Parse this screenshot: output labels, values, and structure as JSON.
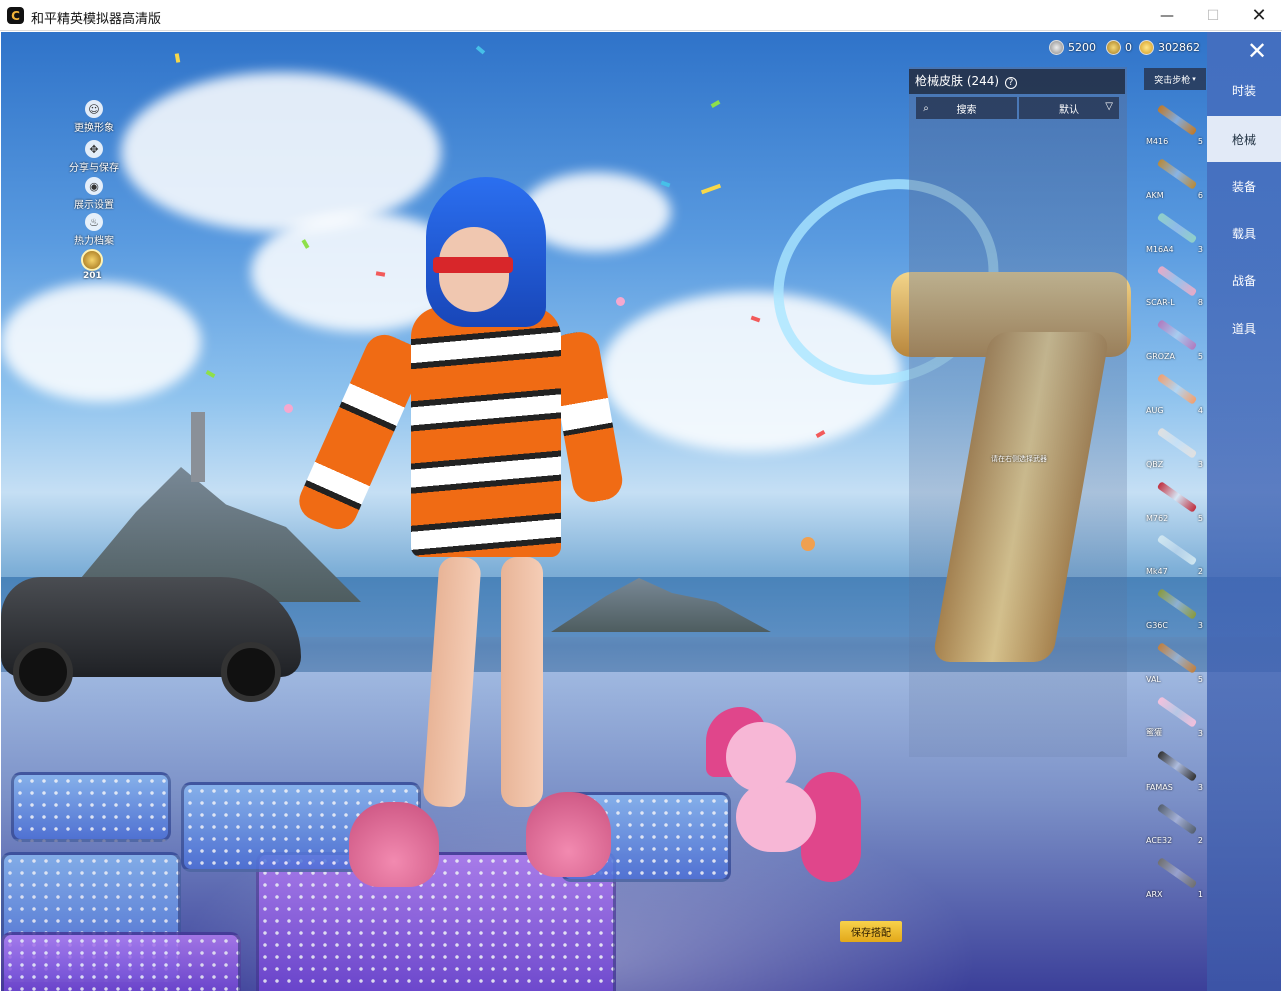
{
  "window": {
    "title": "和平精英模拟器高清版",
    "icon_label": "C",
    "controls": {
      "minimize": "—",
      "maximize": "☐",
      "close": "✕"
    }
  },
  "left_menu": {
    "items": [
      {
        "label": "更换形象",
        "icon": "person-icon"
      },
      {
        "label": "分享与保存",
        "icon": "share-icon"
      },
      {
        "label": "展示设置",
        "icon": "eye-icon"
      },
      {
        "label": "热力档案",
        "icon": "flame-icon"
      }
    ],
    "level_badge": "201"
  },
  "currency": {
    "silver": "5200",
    "tokens": "0",
    "gold": "302862"
  },
  "right_tabs": {
    "close": "✕",
    "items": [
      {
        "label": "时装",
        "active": false
      },
      {
        "label": "枪械",
        "active": true
      },
      {
        "label": "装备",
        "active": false
      },
      {
        "label": "载具",
        "active": false
      },
      {
        "label": "战备",
        "active": false
      },
      {
        "label": "道具",
        "active": false
      }
    ]
  },
  "skin_panel": {
    "title": "枪械皮肤 (244)",
    "help_icon": "?",
    "search_label": "搜索",
    "sort_label": "默认",
    "category_label": "突击步枪",
    "hint": "请在右侧选择武器"
  },
  "weapons": [
    {
      "name": "M416",
      "count": "5",
      "color": "#c07a2a"
    },
    {
      "name": "AKM",
      "count": "6",
      "color": "#b88a3a"
    },
    {
      "name": "M16A4",
      "count": "3",
      "color": "#8fd0c8"
    },
    {
      "name": "SCAR-L",
      "count": "8",
      "color": "#e8a9c6"
    },
    {
      "name": "GROZA",
      "count": "5",
      "color": "#b07cc0"
    },
    {
      "name": "AUG",
      "count": "4",
      "color": "#f0a070"
    },
    {
      "name": "QBZ",
      "count": "3",
      "color": "#e0e0e0"
    },
    {
      "name": "M762",
      "count": "5",
      "color": "#c03040"
    },
    {
      "name": "Mk47",
      "count": "2",
      "color": "#cfe6f0"
    },
    {
      "name": "G36C",
      "count": "3",
      "color": "#8a9a40"
    },
    {
      "name": "VAL",
      "count": "5",
      "color": "#c08040"
    },
    {
      "name": "蜜獾",
      "count": "3",
      "color": "#f3c0dc"
    },
    {
      "name": "FAMAS",
      "count": "3",
      "color": "#333333"
    },
    {
      "name": "ACE32",
      "count": "2",
      "color": "#556070"
    },
    {
      "name": "ARX",
      "count": "1",
      "color": "#707070"
    }
  ],
  "save_button": "保存搭配",
  "colors": {
    "accent_gold": "#f1c232",
    "panel_dark": "#1e283c",
    "tab_bar": "#4a6ec0"
  }
}
